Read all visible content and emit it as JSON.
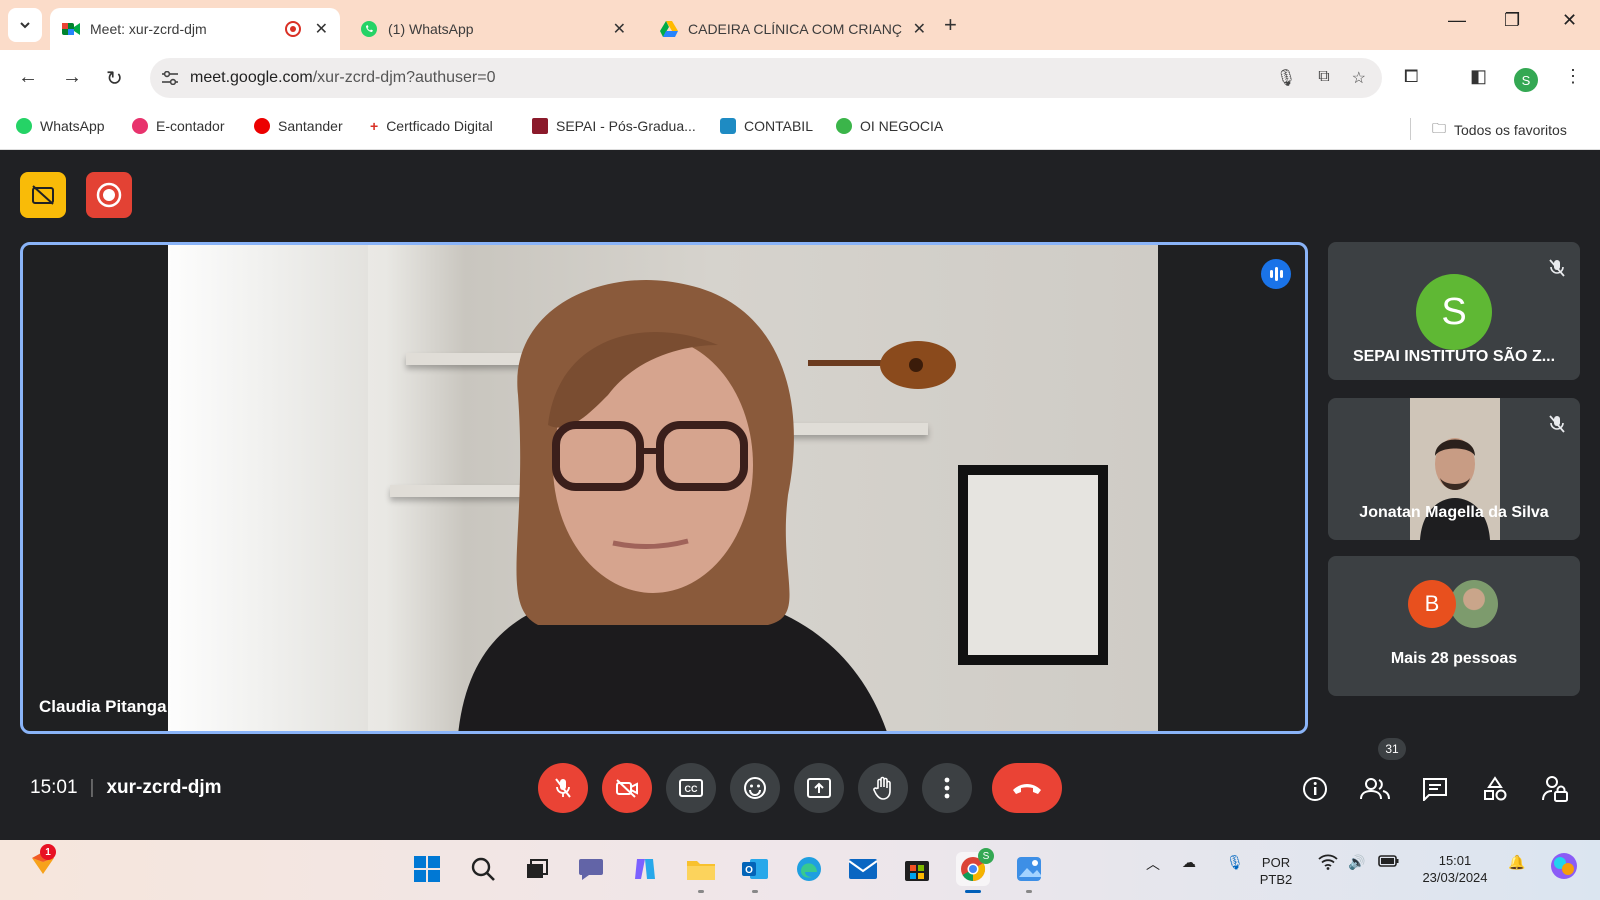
{
  "browser": {
    "tabs": [
      {
        "title": "Meet: xur-zcrd-djm",
        "icon": "google-meet-icon",
        "recording": true
      },
      {
        "title": "(1) WhatsApp",
        "icon": "whatsapp-icon"
      },
      {
        "title": "CADEIRA CLÍNICA COM CRIANÇ",
        "icon": "google-drive-icon"
      }
    ],
    "url_main": "meet.google.com",
    "url_path": "/xur-zcrd-djm?authuser=0",
    "profile_initial": "S",
    "bookmarks": [
      {
        "label": "WhatsApp",
        "color": "#25d366"
      },
      {
        "label": "E-contador",
        "color": "#e8336d"
      },
      {
        "label": "Santander",
        "color": "#ec0000"
      },
      {
        "label": "Certficado Digital",
        "color": "#d93025"
      },
      {
        "label": "SEPAI - Pós-Gradua...",
        "color": "#8b1a2b"
      },
      {
        "label": "CONTABIL",
        "color": "#1e8bc3"
      },
      {
        "label": "OI NEGOCIA",
        "color": "#3bb54a"
      }
    ],
    "all_bookmarks_label": "Todos os favoritos"
  },
  "meet": {
    "main_speaker": "Claudia Pitanga",
    "participants": [
      {
        "name": "SEPAI INSTITUTO SÃO Z...",
        "initial": "S",
        "muted": true
      },
      {
        "name": "Jonatan Magella da Silva",
        "muted": true
      }
    ],
    "more_people": {
      "label": "Mais 28 pessoas",
      "initial": "B"
    },
    "time": "15:01",
    "meeting_code": "xur-zcrd-djm",
    "people_count": "31",
    "colors": {
      "accent": "#8ab4f8",
      "danger": "#ea4335",
      "recording_badge": "#f9bb08",
      "tile": "#3c4043"
    }
  },
  "taskbar": {
    "notification_count": "1",
    "language_line1": "POR",
    "language_line2": "PTB2",
    "time": "15:01",
    "date": "23/03/2024",
    "chrome_badge": "S"
  }
}
